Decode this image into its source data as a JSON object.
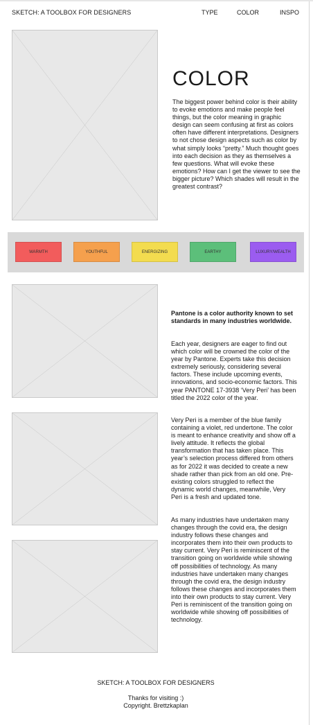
{
  "header": {
    "brand": "SKETCH: A TOOLBOX FOR DESIGNERS",
    "nav": [
      "TYPE",
      "COLOR",
      "INSPO"
    ]
  },
  "hero": {
    "title": "COLOR",
    "body": "The biggest power behind color is their ability to evoke emotions and make people feel things, but the color meaning in graphic design can seem confusing at first as colors often have different interpretations. Designers to not chose design aspects such as color by what simply looks “pretty.” Much thought goes into each decision as they as themselves a few questions. What will evoke these emotions? How can I get the viewer to see the bigger picture? Which shades will result in the greatest contrast?"
  },
  "swatches": [
    {
      "label": "WARMTH",
      "color": "#f25c5c"
    },
    {
      "label": "YOUTHFUL",
      "color": "#f5a04d"
    },
    {
      "label": "ENERGIZING",
      "color": "#f3dc4f"
    },
    {
      "label": "EARTHY",
      "color": "#5cbf7a"
    },
    {
      "label": "LUXURY/WEALTH",
      "color": "#9b5cf0"
    }
  ],
  "pantone": {
    "lead": "Pantone is a color authority known to set standards in many industries worldwide.",
    "p1": "Each year, designers are eager to find out which color will be crowned the color of the year by Pantone. Experts take this decision extremely seriously, considering several factors. These include upcoming events, innovations, and socio-economic factors. This year PANTONE 17-3938 ‘Very Peri’ has been titled the 2022 color of the year.",
    "p2": "Very Peri is a member of the blue family containing a violet, red undertone. The color is meant to enhance creativity and show off a lively attitude. It reflects the global transformation that has taken place. This year’s selection process differed from others as for 2022 it was decided to create a new shade rather than pick from an old one. Pre-existing colors struggled to reflect the dynamic world changes, meanwhile, Very Peri is a fresh and updated tone.",
    "p3": "As many industries have undertaken many changes through the covid era, the design industry follows these changes and incorporates them into their own products to stay current. Very Peri is reminiscent of the transition going on worldwide while showing off possibilities of technology. As many industries have undertaken many changes through the covid era, the design industry follows these changes and incorporates them into their own products to stay current. Very Peri is reminiscent of the transition going on worldwide while showing off possibilities of technology."
  },
  "footer": {
    "brand": "SKETCH: A TOOLBOX FOR DESIGNERS",
    "thanks": "Thanks for visiting :)",
    "copyright": "Copyright. Brettzkaplan"
  }
}
